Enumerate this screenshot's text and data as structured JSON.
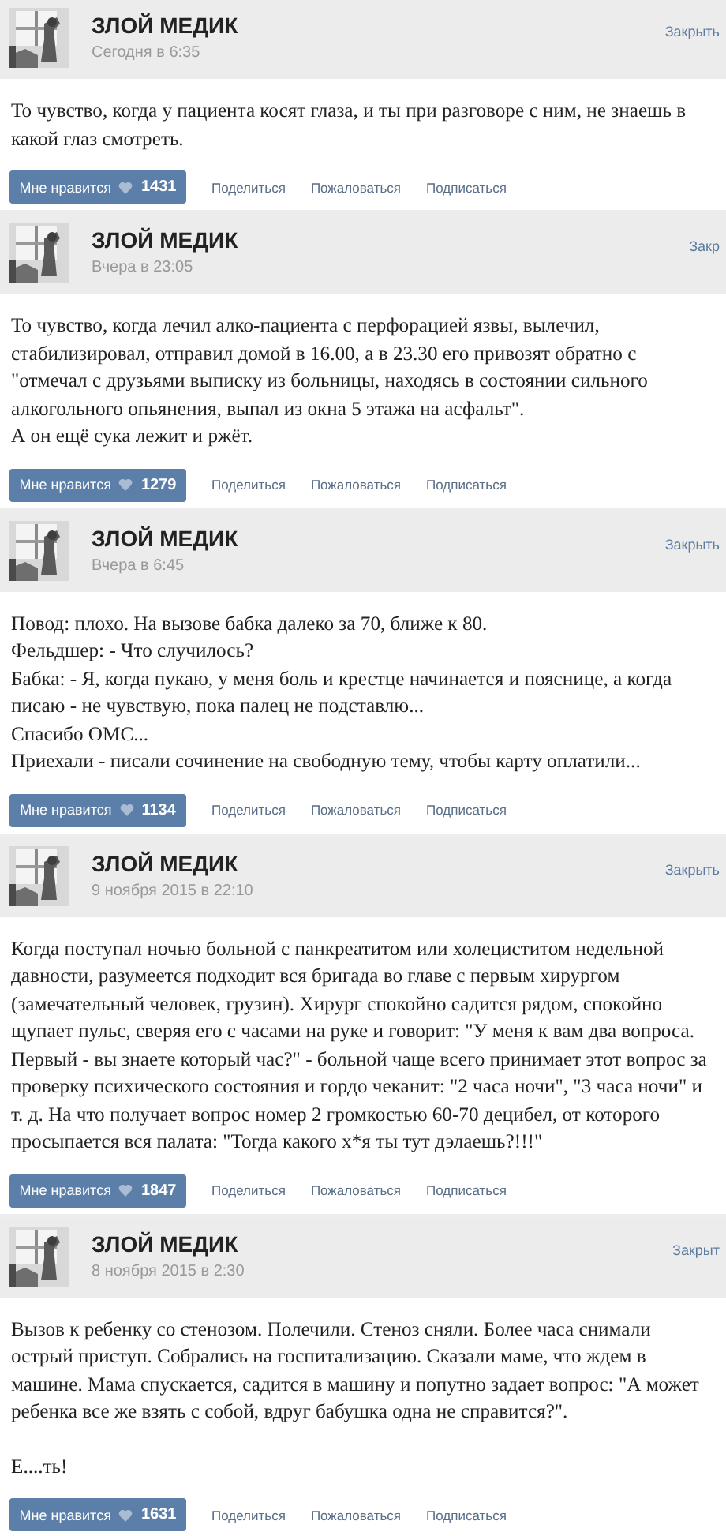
{
  "posts": [
    {
      "author": "ЗЛОЙ МЕДИК",
      "time": "Сегодня в 6:35",
      "close": "Закрыть",
      "paragraphs": [
        [
          "То чувство, когда у пациента косят глаза, и ты при разговоре с ним, не знаешь в какой глаз смотреть."
        ]
      ],
      "like": {
        "label": "Мне нравится",
        "count": "1431"
      },
      "actions": [
        "Поделиться",
        "Пожаловаться",
        "Подписаться"
      ]
    },
    {
      "author": "ЗЛОЙ МЕДИК",
      "time": "Вчера в 23:05",
      "close": "Закр",
      "paragraphs": [
        [
          "То чувство, когда лечил алко-пациента с перфорацией язвы, вылечил, стабилизировал, отправил домой в 16.00, а в 23.30 его привозят обратно с \"отмечал с друзьями выписку из больницы, находясь в состоянии сильного алкогольного опьянения, выпал из окна 5 этажа на асфальт\".",
          "А он ещё сука лежит и ржёт."
        ]
      ],
      "like": {
        "label": "Мне нравится",
        "count": "1279"
      },
      "actions": [
        "Поделиться",
        "Пожаловаться",
        "Подписаться"
      ]
    },
    {
      "author": "ЗЛОЙ МЕДИК",
      "time": "Вчера в 6:45",
      "close": "Закрыть",
      "paragraphs": [
        [
          "Повод: плохо. На вызове бабка далеко за 70, ближе к 80.",
          "Фельдшер: - Что случилось?",
          "Бабка: - Я, когда пукаю, у меня боль и крестце начинается и пояснице, а когда писаю - не чувствую, пока палец не подставлю...",
          "Спасибо ОМС...",
          "Приехали - писали сочинение на свободную тему, чтобы карту оплатили..."
        ]
      ],
      "like": {
        "label": "Мне нравится",
        "count": "1134"
      },
      "actions": [
        "Поделиться",
        "Пожаловаться",
        "Подписаться"
      ]
    },
    {
      "author": "ЗЛОЙ МЕДИК",
      "time": "9 ноября 2015 в 22:10",
      "close": "Закрыть",
      "paragraphs": [
        [
          "Когда поступал ночью больной с панкреатитом или холециститом недельной давности, разумеется подходит вся бригада во главе с первым хирургом (замечательный человек, грузин). Хирург спокойно садится рядом, спокойно щупает пульс, сверяя его с часами на руке и говорит: \"У меня к вам два вопроса. Первый - вы знаете который час?\" - больной чаще всего принимает этот вопрос за проверку психического состояния и гордо чеканит: \"2 часа ночи\", \"3 часа ночи\" и т. д. На что получает вопрос номер 2 громкостью 60-70 децибел, от которого просыпается вся палата: \"Тогда какого х*я ты тут дэлаешь?!!!\""
        ]
      ],
      "like": {
        "label": "Мне нравится",
        "count": "1847"
      },
      "actions": [
        "Поделиться",
        "Пожаловаться",
        "Подписаться"
      ]
    },
    {
      "author": "ЗЛОЙ МЕДИК",
      "time": "8 ноября 2015 в 2:30",
      "close": "Закрыт",
      "paragraphs": [
        [
          "Вызов к ребенку со стенозом. Полечили. Стеноз сняли. Более часа снимали острый приступ. Собрались на госпитализацию. Сказали маме, что ждем в машине. Мама спускается, садится в машину и попутно задает вопрос: \"А может ребенка все же взять с собой, вдруг бабушка одна не справится?\"."
        ],
        [
          "Е....ть!"
        ]
      ],
      "like": {
        "label": "Мне нравится",
        "count": "1631"
      },
      "actions": [
        "Поделиться",
        "Пожаловаться",
        "Подписаться"
      ]
    }
  ]
}
